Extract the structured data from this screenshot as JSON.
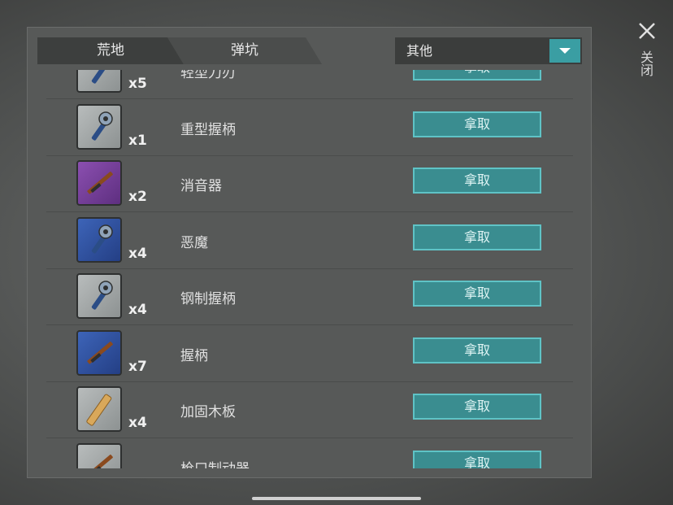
{
  "tabs": [
    {
      "label": "荒地"
    },
    {
      "label": "弹坑"
    }
  ],
  "filter": {
    "selected": "其他"
  },
  "close": {
    "label": "关闭"
  },
  "items": [
    {
      "name": "轻型刀刃",
      "qty": "x5",
      "button": "拿取",
      "rarity": "grey",
      "icon": "tool-icon"
    },
    {
      "name": "重型握柄",
      "qty": "x1",
      "button": "拿取",
      "rarity": "grey",
      "icon": "tool-icon"
    },
    {
      "name": "消音器",
      "qty": "x2",
      "button": "拿取",
      "rarity": "purple",
      "icon": "rifle-icon"
    },
    {
      "name": "恶魔",
      "qty": "x4",
      "button": "拿取",
      "rarity": "blue",
      "icon": "tool-icon"
    },
    {
      "name": "钢制握柄",
      "qty": "x4",
      "button": "拿取",
      "rarity": "grey",
      "icon": "tool-icon"
    },
    {
      "name": "握柄",
      "qty": "x7",
      "button": "拿取",
      "rarity": "blue",
      "icon": "rifle-icon"
    },
    {
      "name": "加固木板",
      "qty": "x4",
      "button": "拿取",
      "rarity": "grey",
      "icon": "plank-icon"
    },
    {
      "name": "枪口制动器",
      "qty": "",
      "button": "拿取",
      "rarity": "grey",
      "icon": "rifle-icon"
    }
  ],
  "colors": {
    "accent": "#3a9ea3",
    "button_border": "#5fc3c6"
  }
}
